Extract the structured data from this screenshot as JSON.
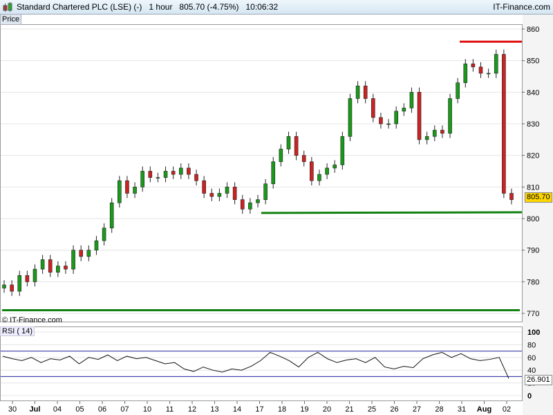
{
  "header": {
    "title": "Standard Chartered PLC (LSE) (-)   1 hour   805.70 (-4.75%)   10:06:32",
    "brand": "IT-Finance.com",
    "icon": "candlestick-icon"
  },
  "price_label": "Price",
  "watermark": "© IT-Finance.com",
  "rsi_label": "RSI ( 14)",
  "last_price": "805.70",
  "last_rsi": "26.901",
  "colors": {
    "up": "#1a9a1a",
    "down": "#cc2222",
    "resistance": "#e01010",
    "support": "#108010",
    "rsi_band": "#2020a0",
    "tag": "#ffd700"
  },
  "chart_data": {
    "type": "candlestick",
    "price_axis": {
      "ticks": [
        860,
        850,
        840,
        830,
        820,
        810,
        800,
        790,
        780,
        770
      ],
      "range": [
        768,
        862
      ]
    },
    "rsi_axis": {
      "ticks": [
        100,
        80,
        60,
        40,
        20,
        0
      ],
      "bands": [
        70,
        30
      ]
    },
    "x_labels": [
      "30",
      "Jul",
      "04",
      "05",
      "06",
      "07",
      "10",
      "11",
      "12",
      "13",
      "14",
      "17",
      "18",
      "19",
      "20",
      "21",
      "25",
      "26",
      "27",
      "28",
      "31",
      "Aug",
      "02"
    ],
    "closes": [
      779,
      777,
      782,
      780,
      784,
      787,
      783,
      785,
      784,
      790,
      788,
      790,
      793,
      797,
      805,
      812,
      808,
      810,
      815,
      813,
      813,
      815,
      814,
      816,
      814,
      812,
      808,
      807,
      808,
      810,
      806,
      803,
      805,
      806,
      811,
      818,
      822,
      826,
      820,
      818,
      812,
      814,
      816,
      817,
      826,
      838,
      842,
      838,
      832,
      830,
      830,
      834,
      835,
      840,
      825,
      826,
      828,
      827,
      838,
      843,
      849,
      848,
      846,
      846,
      852,
      808,
      806
    ],
    "rsi": [
      62,
      58,
      55,
      60,
      52,
      58,
      56,
      62,
      50,
      60,
      57,
      64,
      55,
      62,
      58,
      60,
      55,
      50,
      52,
      42,
      38,
      45,
      40,
      37,
      42,
      40,
      46,
      55,
      68,
      62,
      55,
      45,
      60,
      68,
      58,
      52,
      56,
      58,
      52,
      60,
      45,
      42,
      46,
      44,
      58,
      64,
      68,
      60,
      66,
      58,
      55,
      57,
      60,
      27
    ],
    "resistance": 856,
    "support_lines": [
      802,
      771
    ]
  }
}
